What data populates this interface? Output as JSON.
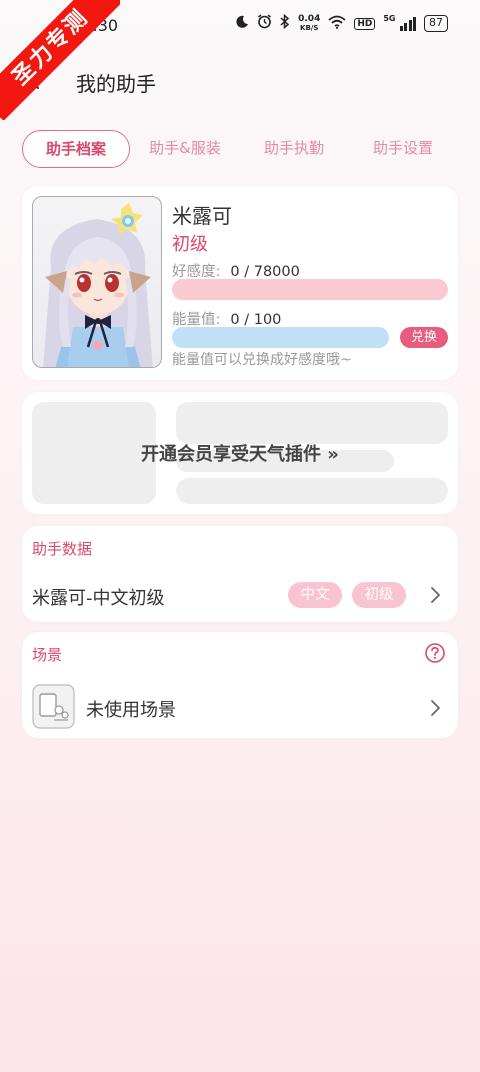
{
  "status_bar": {
    "time": "15:30",
    "speed_value": "0.04",
    "speed_unit": "KB/S",
    "hd_label": "HD",
    "network_label": "5G",
    "battery": "87"
  },
  "ribbon": {
    "text": "圣力专测",
    "color": "#f2180f"
  },
  "header": {
    "title": "我的助手",
    "back_icon": "back-arrow-icon"
  },
  "tabs": [
    {
      "label": "助手档案",
      "active": true
    },
    {
      "label": "助手&服装",
      "active": false
    },
    {
      "label": "助手执勤",
      "active": false
    },
    {
      "label": "助手设置",
      "active": false
    }
  ],
  "profile": {
    "name": "米露可",
    "level": "初级",
    "favor_label": "好感度:",
    "favor_value": "0 / 78000",
    "favor_fraction": 0,
    "energy_label": "能量值:",
    "energy_value": "0 / 100",
    "energy_fraction": 0,
    "exchange_label": "兑换",
    "tip": "能量值可以兑换成好感度哦~"
  },
  "vip_promo": {
    "text": "开通会员享受天气插件 »"
  },
  "assistant_data": {
    "title": "助手数据",
    "row_label": "米露可-中文初级",
    "tags": [
      "中文",
      "初级"
    ]
  },
  "scene": {
    "title": "场景",
    "row_label": "未使用场景"
  },
  "colors": {
    "accent": "#d9496d",
    "tag_bg": "#f8c4cf",
    "favor_bar": "#fac9d2",
    "energy_bar": "#c0e0f5",
    "exchange_button": "#e85d7d"
  }
}
